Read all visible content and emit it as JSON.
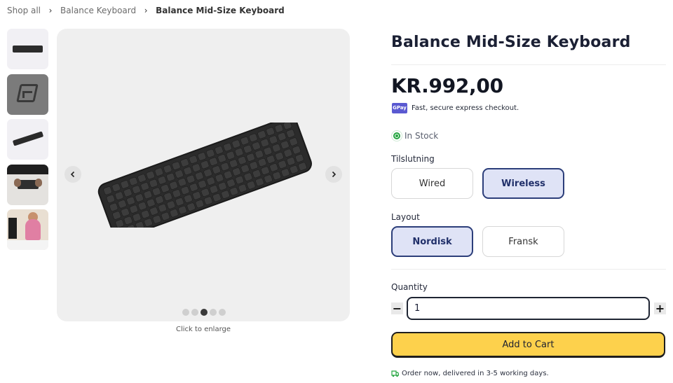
{
  "breadcrumb": {
    "items": [
      "Shop all",
      "Balance Keyboard"
    ],
    "current": "Balance Mid-Size Keyboard",
    "separator": "›"
  },
  "gallery": {
    "thumbnails": [
      "keyboard-front",
      "keyboard-stand",
      "keyboard-side",
      "keyboard-on-desk",
      "person-at-desk"
    ],
    "dots_total": 5,
    "active_dot": 3,
    "enlarge_hint": "Click to enlarge"
  },
  "product": {
    "title": "Balance Mid-Size Keyboard",
    "price": "KR.992,00",
    "express_badge": "GPay",
    "express_text": "Fast, secure express checkout.",
    "stock": "In Stock"
  },
  "options": {
    "connection": {
      "label": "Tilslutning",
      "choices": [
        "Wired",
        "Wireless"
      ],
      "selected": "Wireless"
    },
    "layout": {
      "label": "Layout",
      "choices": [
        "Nordisk",
        "Fransk"
      ],
      "selected": "Nordisk"
    }
  },
  "quantity": {
    "label": "Quantity",
    "value": "1",
    "minus": "−",
    "plus": "+"
  },
  "cart": {
    "button_label": "Add to Cart",
    "delivery_text": "Order now, delivered in 3-5 working days."
  },
  "colors": {
    "accent_yellow": "#fdd14c",
    "selected_bg": "#dfe3f6",
    "selected_border": "#2c3e7a",
    "in_stock_green": "#23a53f"
  }
}
